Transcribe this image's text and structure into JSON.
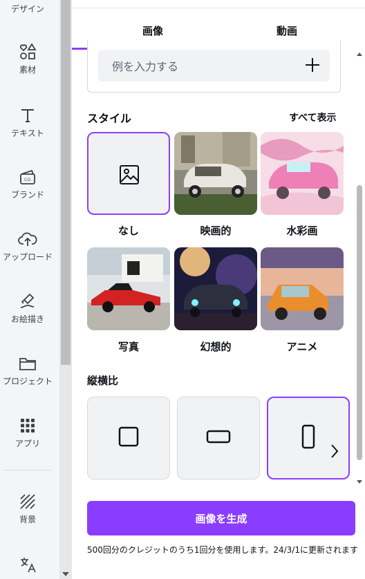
{
  "sidebar": {
    "items": [
      {
        "label": "デザイン",
        "icon": "design-icon"
      },
      {
        "label": "素材",
        "icon": "elements-icon"
      },
      {
        "label": "テキスト",
        "icon": "text-icon"
      },
      {
        "label": "ブランド",
        "icon": "brand-icon"
      },
      {
        "label": "アップロード",
        "icon": "upload-cloud-icon"
      },
      {
        "label": "お絵描き",
        "icon": "draw-icon"
      },
      {
        "label": "プロジェクト",
        "icon": "folder-icon"
      },
      {
        "label": "アプリ",
        "icon": "apps-grid-icon"
      },
      {
        "label": "背景",
        "icon": "background-icon"
      },
      {
        "label": "",
        "icon": "translate-icon"
      }
    ]
  },
  "tabs": [
    {
      "label": "画像",
      "active": true
    },
    {
      "label": "動画",
      "active": false
    }
  ],
  "prompt": {
    "placeholder": "例を入力する"
  },
  "style_section": {
    "title": "スタイル",
    "see_all": "すべて表示",
    "styles": [
      {
        "label": "なし",
        "selected": true
      },
      {
        "label": "映画的",
        "selected": false
      },
      {
        "label": "水彩画",
        "selected": false
      },
      {
        "label": "写真",
        "selected": false
      },
      {
        "label": "幻想的",
        "selected": false
      },
      {
        "label": "アニメ",
        "selected": false
      }
    ]
  },
  "ratio_section": {
    "title": "縦横比",
    "ratios": [
      {
        "icon": "square-ratio-icon",
        "selected": false
      },
      {
        "icon": "landscape-ratio-icon",
        "selected": false
      },
      {
        "icon": "portrait-ratio-icon",
        "selected": true
      }
    ]
  },
  "generate_button": "画像を生成",
  "credit_note": "500回分のクレジットのうち1回分を使用します。24/3/1に更新されます",
  "colors": {
    "accent": "#8b3dff",
    "sidebar_bg": "#f4f5f7",
    "tile_bg": "#f1f2f4"
  }
}
